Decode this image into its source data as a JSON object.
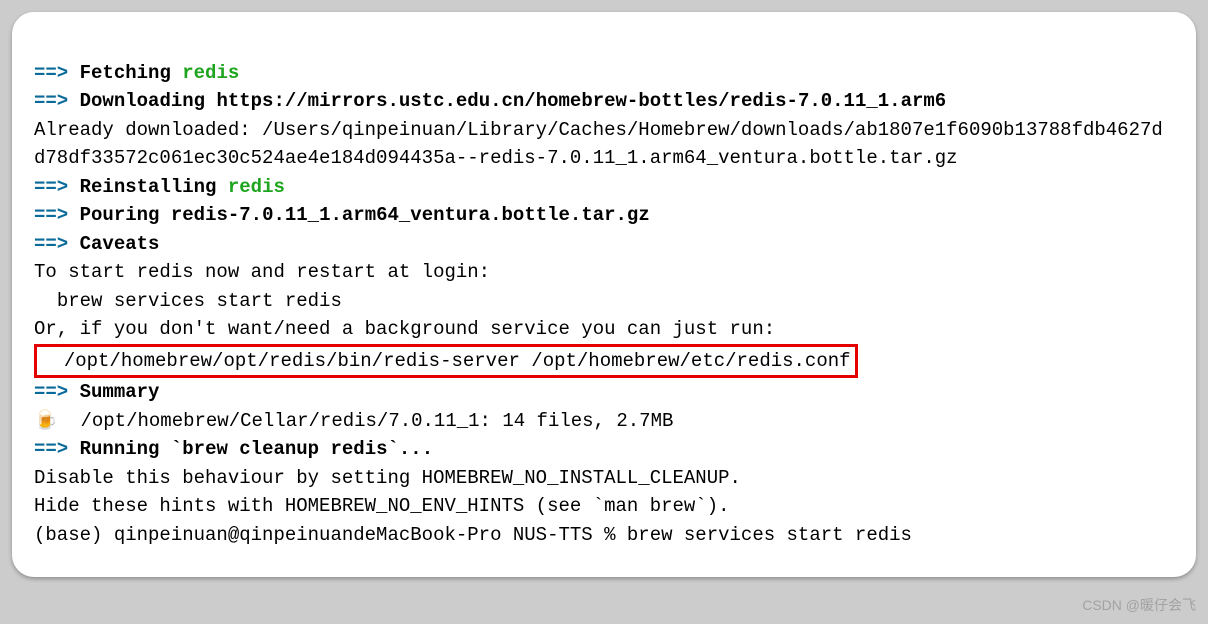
{
  "arrow": "==>",
  "lines": {
    "l1_prefix": "Fetching",
    "l1_pkg": "redis",
    "l2_prefix": "Downloading",
    "l2_url": "https://mirrors.ustc.edu.cn/homebrew-bottles/redis-7.0.11_1.arm6",
    "l3": "Already downloaded: /Users/qinpeinuan/Library/Caches/Homebrew/downloads/ab1807e1f6090b13788fdb4627dd78df33572c061ec30c524ae4e184d094435a--redis-7.0.11_1.arm64_ventura.bottle.tar.gz",
    "l4_prefix": "Reinstalling",
    "l4_pkg": "redis",
    "l5_prefix": "Pouring",
    "l5_file": "redis-7.0.11_1.arm64_ventura.bottle.tar.gz",
    "l6": "Caveats",
    "l7": "To start redis now and restart at login:",
    "l8": "  brew services start redis",
    "l9": "Or, if you don't want/need a background service you can just run:",
    "l10": "  /opt/homebrew/opt/redis/bin/redis-server /opt/homebrew/etc/redis.conf",
    "l11": "Summary",
    "l12_icon": "🍺",
    "l12_text": "  /opt/homebrew/Cellar/redis/7.0.11_1: 14 files, 2.7MB",
    "l13_prefix": "Running",
    "l13_cmd": "`brew cleanup redis`...",
    "l14": "Disable this behaviour by setting HOMEBREW_NO_INSTALL_CLEANUP.",
    "l15": "Hide these hints with HOMEBREW_NO_ENV_HINTS (see `man brew`).",
    "l16": "(base) qinpeinuan@qinpeinuandeMacBook-Pro NUS-TTS % brew services start redis"
  },
  "watermark": "CSDN @暖仔会飞"
}
